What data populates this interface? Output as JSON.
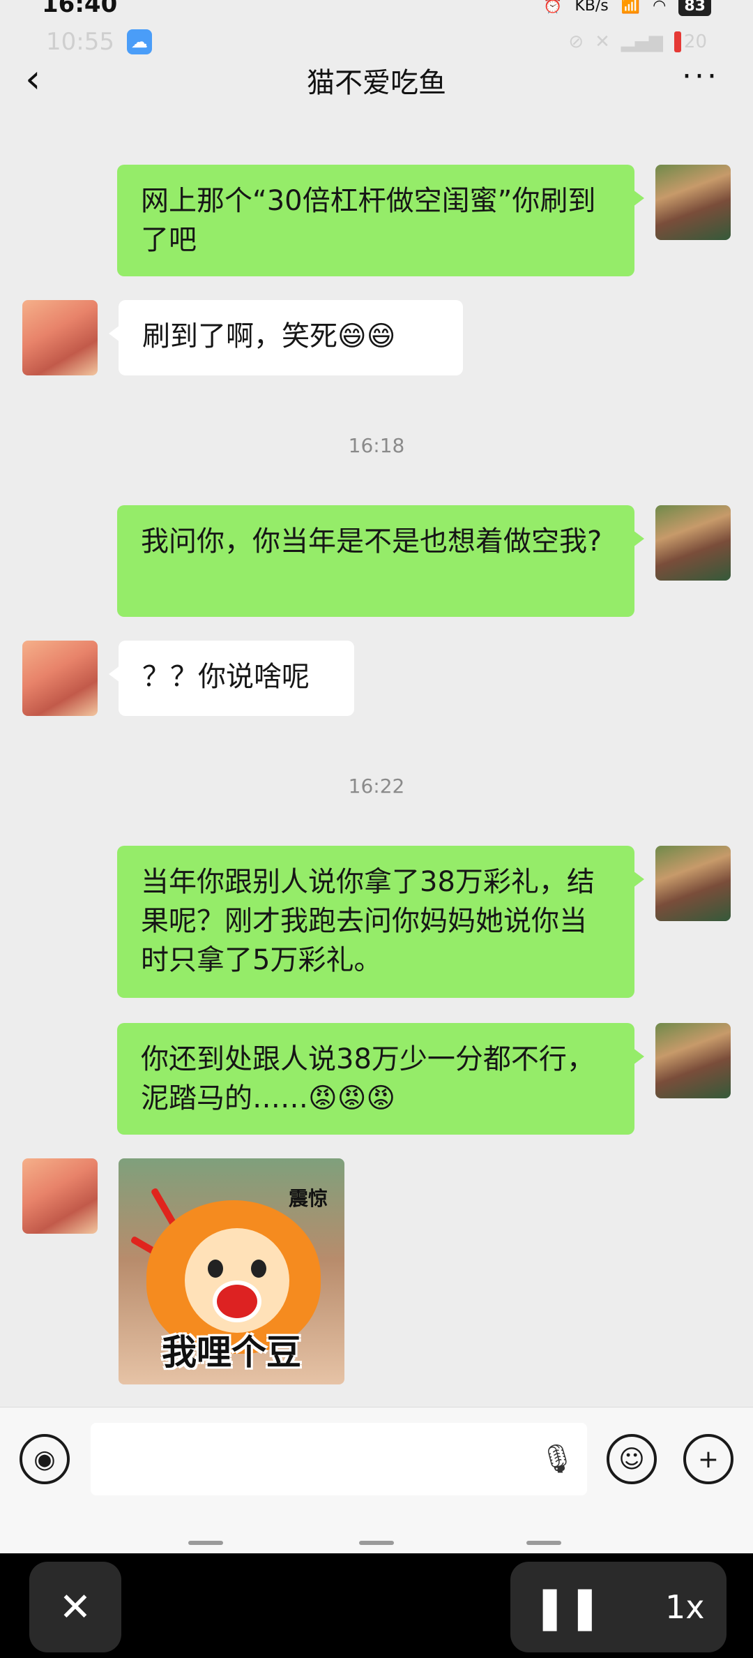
{
  "status_outer": {
    "time": "16:40",
    "speed": "KB/s",
    "battery": "83"
  },
  "status_inner": {
    "time": "10:55",
    "battery": "20"
  },
  "header": {
    "title": "猫不爱吃鱼"
  },
  "messages": [
    {
      "side": "right",
      "text": "网上那个“30倍杠杆做空闺蜜”你刷到了吧"
    },
    {
      "side": "left",
      "text": "刷到了啊，笑死😄😄"
    },
    {
      "side": "right",
      "text": "我问你，你当年是不是也想着做空我?"
    },
    {
      "side": "left",
      "text": "？？你说啥呢"
    },
    {
      "side": "right",
      "text": "当年你跟别人说你拿了38万彩礼，结果呢？刚才我跑去问你妈妈她说你当时只拿了5万彩礼。"
    },
    {
      "side": "right",
      "text": "你还到处跟人说38万少一分都不行，泥踏马的……😡😡😡"
    }
  ],
  "timestamps": [
    "16:18",
    "16:22"
  ],
  "sticker": {
    "top_text": "震惊",
    "bottom_text": "我哩个豆"
  },
  "player": {
    "speed": "1x"
  }
}
